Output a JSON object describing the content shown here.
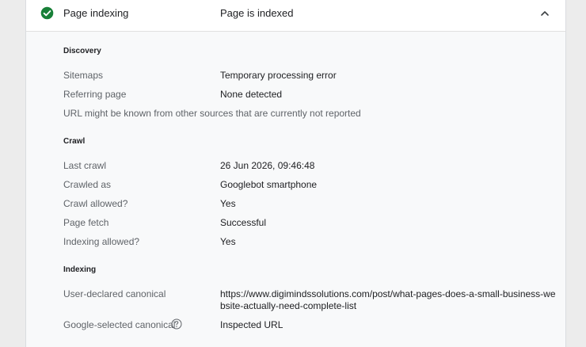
{
  "header": {
    "title": "Page indexing",
    "status": "Page is indexed",
    "status_color": "#188038"
  },
  "discovery": {
    "title": "Discovery",
    "sitemaps_label": "Sitemaps",
    "sitemaps_value": "Temporary processing error",
    "referring_label": "Referring page",
    "referring_value": "None detected",
    "note": "URL might be known from other sources that are currently not reported"
  },
  "crawl": {
    "title": "Crawl",
    "last_crawl_label": "Last crawl",
    "last_crawl_value": "26 Jun 2026, 09:46:48",
    "crawled_as_label": "Crawled as",
    "crawled_as_value": "Googlebot smartphone",
    "crawl_allowed_label": "Crawl allowed?",
    "crawl_allowed_value": "Yes",
    "page_fetch_label": "Page fetch",
    "page_fetch_value": "Successful",
    "indexing_allowed_label": "Indexing allowed?",
    "indexing_allowed_value": "Yes"
  },
  "indexing": {
    "title": "Indexing",
    "user_canonical_label": "User-declared canonical",
    "user_canonical_value": "https://www.digimindssolutions.com/post/what-pages-does-a-small-business-website-actually-need-complete-list",
    "google_canonical_label": "Google-selected canonical",
    "google_canonical_value": "Inspected URL"
  },
  "icons": {
    "status": "check-circle-icon",
    "collapse": "chevron-up-icon",
    "help": "help-circle-icon"
  }
}
